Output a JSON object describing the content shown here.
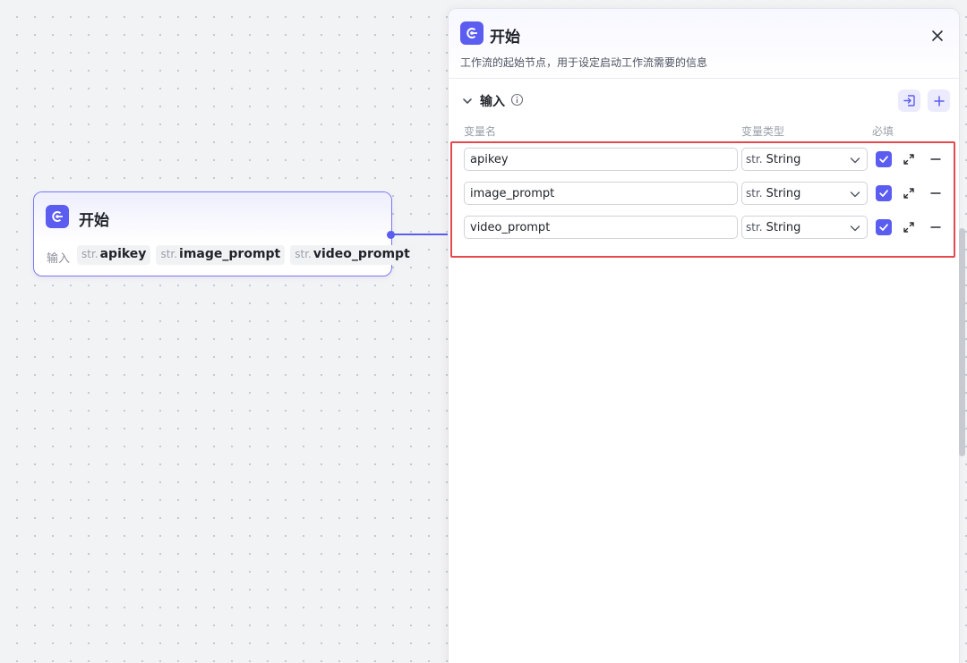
{
  "canvas": {
    "node": {
      "title": "开始",
      "input_label": "输入",
      "params": [
        {
          "type": "str.",
          "name": "apikey"
        },
        {
          "type": "str.",
          "name": "image_prompt"
        },
        {
          "type": "str.",
          "name": "video_prompt"
        }
      ]
    }
  },
  "panel": {
    "title": "开始",
    "description": "工作流的起始节点，用于设定启动工作流需要的信息",
    "section": {
      "title": "输入",
      "columns": {
        "name": "变量名",
        "type": "变量类型",
        "required": "必填"
      },
      "variables": [
        {
          "name": "apikey",
          "type_prefix": "str.",
          "type": "String",
          "required": true
        },
        {
          "name": "image_prompt",
          "type_prefix": "str.",
          "type": "String",
          "required": true
        },
        {
          "name": "video_prompt",
          "type_prefix": "str.",
          "type": "String",
          "required": true
        }
      ]
    }
  },
  "colors": {
    "accent": "#5b5cf0",
    "highlight": "#e5484d"
  },
  "icons": {
    "app": "start-node-icon",
    "close": "close-icon",
    "chevron": "chevron-down-icon",
    "info": "info-icon",
    "import": "import-icon",
    "add": "plus-icon",
    "expand": "expand-icon",
    "remove": "minus-icon",
    "check": "check-icon"
  }
}
